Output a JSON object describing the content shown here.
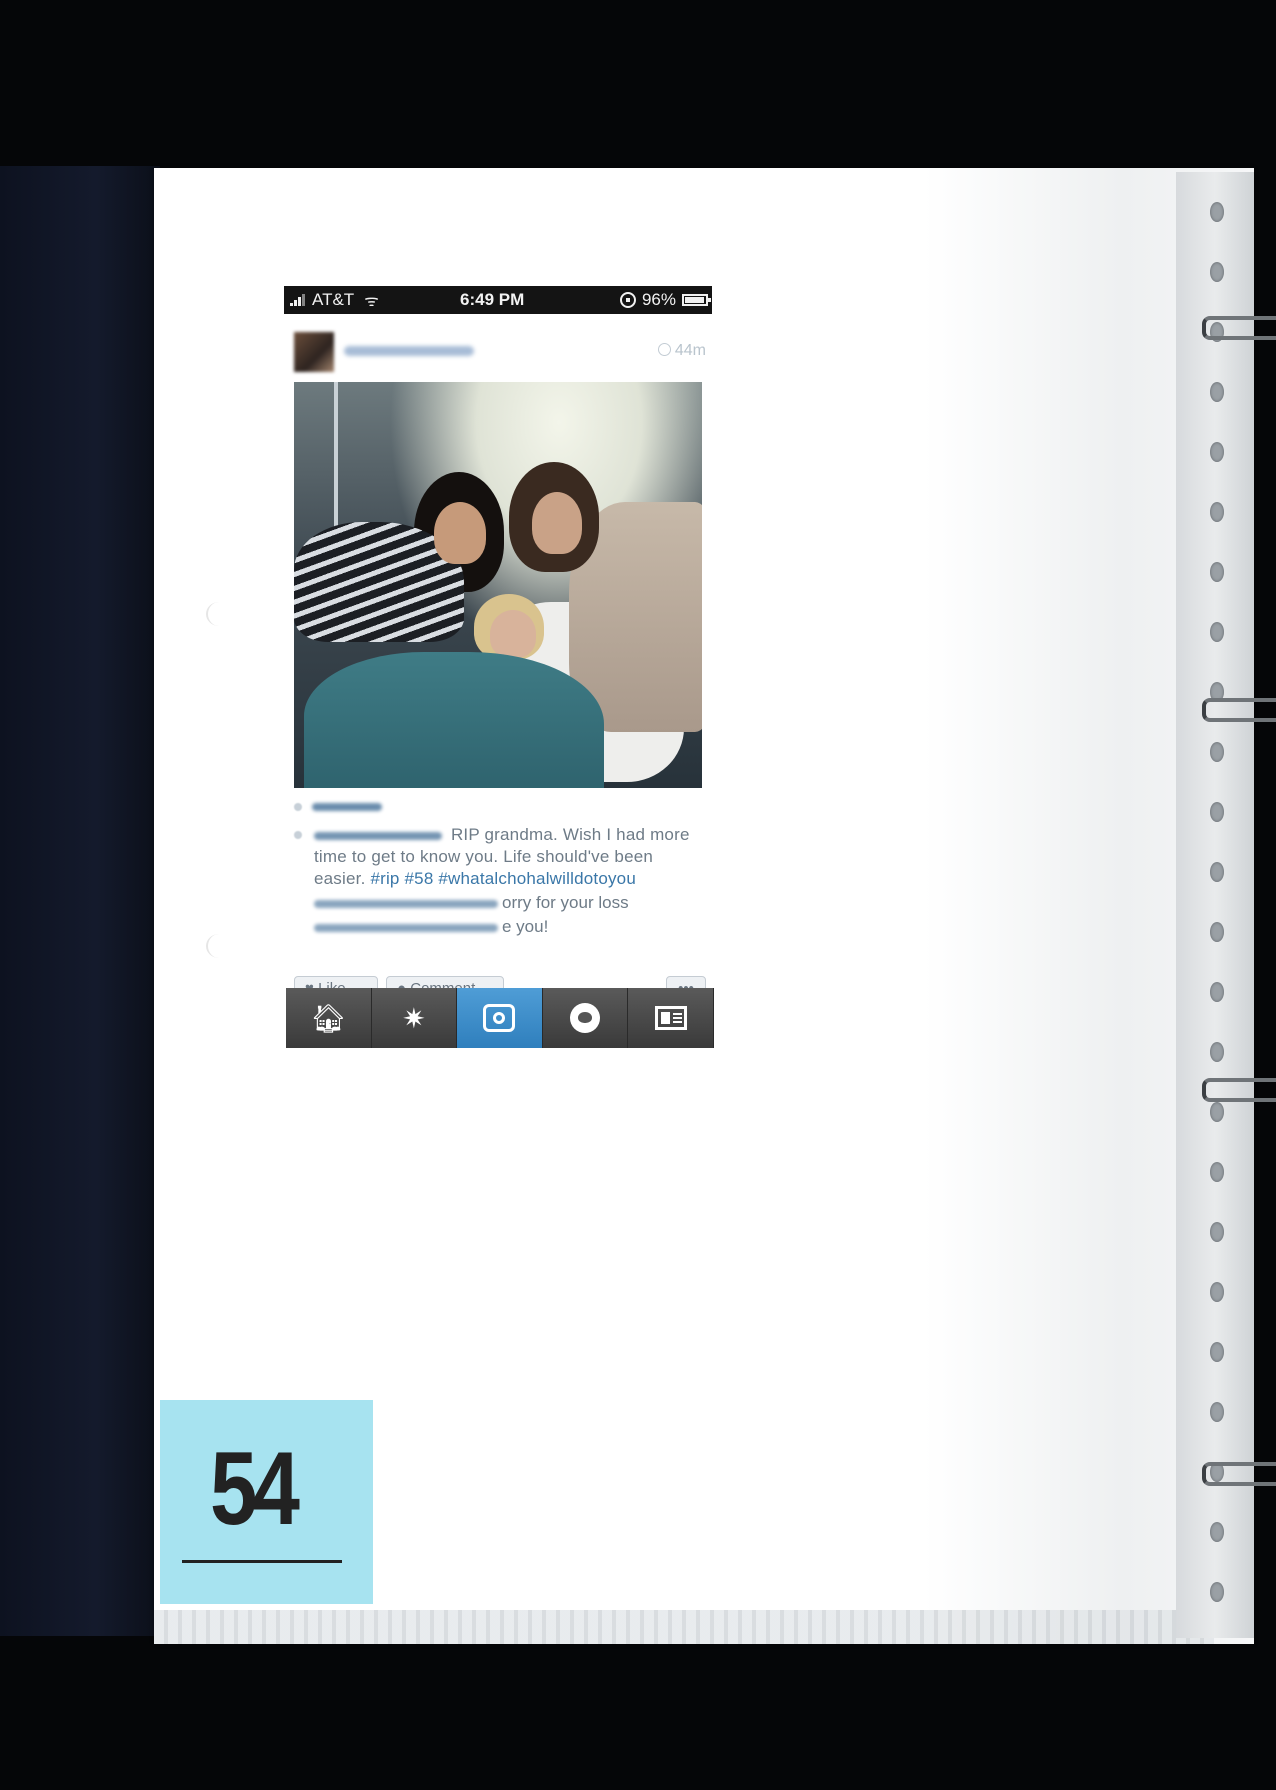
{
  "status_bar": {
    "carrier": "AT&T",
    "time": "6:49 PM",
    "battery": "96%"
  },
  "post": {
    "time_ago": "44m",
    "caption_text": "RIP grandma. Wish I had more time to get to know you. Life should've been easier.",
    "caption_hashtags": "#rip #58 #whatalchohalwilldotoyou",
    "comment_1_text": "orry for your loss",
    "comment_2_text": "e you!",
    "like_button": "Like",
    "comment_button": "Comment",
    "more_button": "•••"
  },
  "tab_bar": {
    "tabs": [
      {
        "icon": "home-icon"
      },
      {
        "icon": "explore-icon"
      },
      {
        "icon": "camera-icon",
        "active": true
      },
      {
        "icon": "activity-icon"
      },
      {
        "icon": "profile-icon"
      }
    ],
    "home_glyph": "🏠︎",
    "explore_glyph": "✷"
  },
  "exhibit": {
    "number": "54"
  },
  "colors": {
    "tab_active": "#3a8bca",
    "label_bg": "#a7e3f0",
    "hashtag": "#3a77a8"
  }
}
